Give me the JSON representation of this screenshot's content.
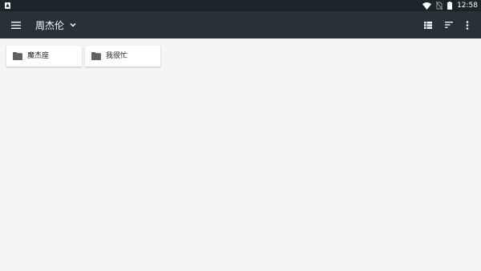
{
  "status_bar": {
    "time": "12:58",
    "icons": [
      "notification-icon",
      "wifi-icon",
      "no-sim-icon",
      "battery-icon"
    ]
  },
  "toolbar": {
    "title": "周杰伦",
    "icons": [
      "menu-icon",
      "chevron-down-icon",
      "view-list-icon",
      "sort-icon",
      "more-vert-icon"
    ]
  },
  "folders": [
    {
      "name": "魔杰座",
      "icon": "folder-icon"
    },
    {
      "name": "我很忙",
      "icon": "folder-icon"
    }
  ],
  "colors": {
    "status_bar": "#1c2529",
    "toolbar": "#263238",
    "background": "#f5f5f5",
    "card": "#ffffff",
    "folder_icon": "#616161"
  }
}
